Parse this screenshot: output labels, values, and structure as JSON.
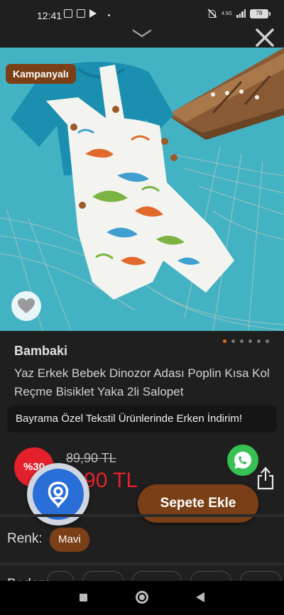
{
  "status_bar": {
    "time": "12:41",
    "network": "4.5G",
    "battery": "78",
    "icons": [
      "image-icon",
      "photo-icon",
      "play-icon",
      "mute-icon",
      "signal-icon",
      "battery-icon"
    ]
  },
  "header": {
    "collapse_icon": "chevron-down-icon",
    "close_icon": "close-icon"
  },
  "gallery": {
    "badge": "Kampanyalı",
    "image_description_icon": "product-photo",
    "slide_count": 6,
    "active_slide": 1
  },
  "product": {
    "brand": "Bambaki",
    "title": "Yaz Erkek Bebek Dinozor Adası Poplin Kısa Kol Reçme Bisiklet Yaka 2li Salopet",
    "promo_text": "Bayrama Özel Tekstil Ürünlerinde Erken İndirim!",
    "discount_badge": "%30",
    "old_price": "89,90 TL",
    "new_price": "62,90 TL",
    "new_price_visible": "4,90 TL"
  },
  "actions": {
    "add_to_cart": "Sepete Ekle"
  },
  "options": {
    "color_label": "Renk:",
    "color_value": "Mavi",
    "size_label": "Beden:"
  },
  "colors": {
    "accent": "#7a3f16",
    "sale": "#e4202c",
    "background": "#1f1f1f",
    "whatsapp": "#36c152",
    "logo": "#2a6ed8"
  }
}
